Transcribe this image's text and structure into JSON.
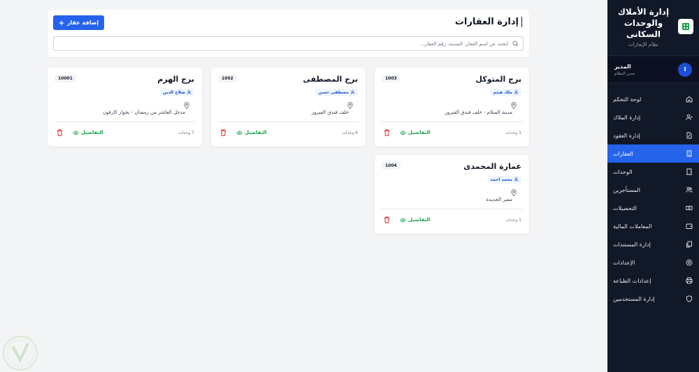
{
  "sidebar": {
    "title_line1": "إدارة الأملاك",
    "title_line2": "والوحدات",
    "title_line3": "السكانى",
    "subtitle": "نظام الإيجارات",
    "user": {
      "avatar_letter": "I",
      "name": "المدير",
      "role": "مدير النظام"
    },
    "items": [
      {
        "label": "لوحة التحكم",
        "icon": "home-icon"
      },
      {
        "label": "إدارة الملاك",
        "icon": "user-check-icon"
      },
      {
        "label": "إدارة العقود",
        "icon": "file-edit-icon"
      },
      {
        "label": "العقارات",
        "icon": "building-icon",
        "active": true
      },
      {
        "label": "الوحدات",
        "icon": "door-icon"
      },
      {
        "label": "المستأجرين",
        "icon": "users-icon"
      },
      {
        "label": "التحصيلات",
        "icon": "banknote-icon"
      },
      {
        "label": "المعاملات المالية",
        "icon": "wallet-icon"
      },
      {
        "label": "إدارة المستندات",
        "icon": "documents-icon"
      },
      {
        "label": "الإعدادات",
        "icon": "gear-icon"
      },
      {
        "label": "إعدادات الطباعة",
        "icon": "printer-icon"
      },
      {
        "label": "إدارة المستخدمين",
        "icon": "shield-icon"
      }
    ],
    "active_color": "#2563eb"
  },
  "header": {
    "title": "إدارة العقارات",
    "add_button_label": "إضافة عقار",
    "search_placeholder": "ابحث عن اسم العقار، المدينة، رقم العقار..."
  },
  "properties": [
    {
      "name": "برج المتوكل",
      "code": "1003",
      "owner": "ملك هيثم",
      "address": "مدينة السلام - خلف فندق الفيروز",
      "units": "1 وحدات",
      "details_label": "التفاصيل"
    },
    {
      "name": "برج المصطفى",
      "code": "1002",
      "owner": "مصطفى حسن",
      "address": "خلف فندق الفيروز",
      "units": "6 وحدات",
      "details_label": "التفاصيل"
    },
    {
      "name": "برج الهرم",
      "code": "10001",
      "owner": "صلاح الدين",
      "address": "مدخل العاشر من رمضان - بجوار كارفون",
      "units": "7 وحدات",
      "details_label": "التفاصيل"
    },
    {
      "name": "عمارة المحمدى",
      "code": "1004",
      "owner": "محمد احمد",
      "address": "مصر الجديدة",
      "units": "1 وحدات",
      "details_label": "التفاصيل"
    }
  ],
  "colors": {
    "primary": "#2563eb",
    "success": "#16a34a",
    "danger": "#dc2626",
    "sidebar_bg": "#111827"
  }
}
